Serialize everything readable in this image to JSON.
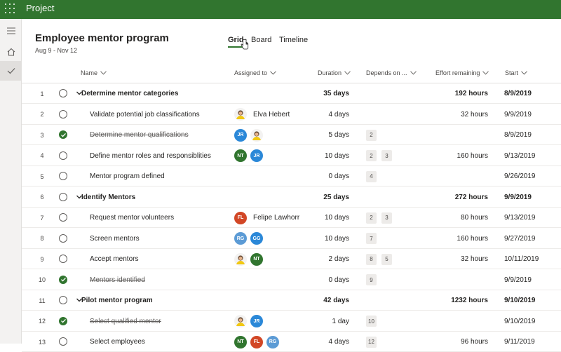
{
  "app": {
    "title": "Project"
  },
  "project": {
    "title": "Employee mentor program",
    "dates": "Aug 9 - Nov 12"
  },
  "tabs": [
    {
      "label": "Grid",
      "active": true
    },
    {
      "label": "Board"
    },
    {
      "label": "Timeline"
    }
  ],
  "columns": {
    "name": "Name",
    "assigned": "Assigned to",
    "duration": "Duration",
    "depends": "Depends on ...",
    "effort": "Effort remaining",
    "start": "Start"
  },
  "colors": {
    "brand": "#31752f",
    "complete": "#31752f"
  },
  "tasks": [
    {
      "num": "1",
      "name": "Determine mentor categories",
      "summary": true,
      "complete": false,
      "assignees": [],
      "assignee_name": "",
      "duration": "35 days",
      "depends": [],
      "effort": "192 hours",
      "start": "8/9/2019"
    },
    {
      "num": "2",
      "name": "Validate potential job classifications",
      "summary": false,
      "complete": false,
      "assignees": [
        {
          "type": "photo"
        }
      ],
      "assignee_name": "Elva Hebert",
      "duration": "4 days",
      "depends": [],
      "effort": "32 hours",
      "start": "9/9/2019"
    },
    {
      "num": "3",
      "name": "Determine mentor qualifications",
      "summary": false,
      "complete": true,
      "assignees": [
        {
          "initials": "JR",
          "color": "#2b88d8"
        },
        {
          "type": "photo"
        }
      ],
      "assignee_name": "",
      "duration": "5 days",
      "depends": [
        "2"
      ],
      "effort": "",
      "start": "8/9/2019"
    },
    {
      "num": "4",
      "name": "Define mentor roles and responsiblities",
      "summary": false,
      "complete": false,
      "assignees": [
        {
          "initials": "NT",
          "color": "#31752f"
        },
        {
          "initials": "JR",
          "color": "#2b88d8"
        }
      ],
      "assignee_name": "",
      "duration": "10 days",
      "depends": [
        "2",
        "3"
      ],
      "effort": "160 hours",
      "start": "9/13/2019"
    },
    {
      "num": "5",
      "name": "Mentor program defined",
      "summary": false,
      "complete": false,
      "assignees": [],
      "assignee_name": "",
      "duration": "0 days",
      "depends": [
        "4"
      ],
      "effort": "",
      "start": "9/26/2019"
    },
    {
      "num": "6",
      "name": "Identify Mentors",
      "summary": true,
      "complete": false,
      "assignees": [],
      "assignee_name": "",
      "duration": "25 days",
      "depends": [],
      "effort": "272 hours",
      "start": "9/9/2019"
    },
    {
      "num": "7",
      "name": "Request mentor volunteers",
      "summary": false,
      "complete": false,
      "assignees": [
        {
          "initials": "FL",
          "color": "#d24726"
        }
      ],
      "assignee_name": "Felipe Lawhorr",
      "duration": "10 days",
      "depends": [
        "2",
        "3"
      ],
      "effort": "80 hours",
      "start": "9/13/2019"
    },
    {
      "num": "8",
      "name": "Screen mentors",
      "summary": false,
      "complete": false,
      "assignees": [
        {
          "initials": "RG",
          "color": "#5c9bd5"
        },
        {
          "initials": "GG",
          "color": "#2b88d8"
        }
      ],
      "assignee_name": "",
      "duration": "10 days",
      "depends": [
        "7"
      ],
      "effort": "160 hours",
      "start": "9/27/2019"
    },
    {
      "num": "9",
      "name": "Accept mentors",
      "summary": false,
      "complete": false,
      "assignees": [
        {
          "type": "photo"
        },
        {
          "initials": "NT",
          "color": "#31752f"
        }
      ],
      "assignee_name": "",
      "duration": "2 days",
      "depends": [
        "8",
        "5"
      ],
      "effort": "32 hours",
      "start": "10/11/2019"
    },
    {
      "num": "10",
      "name": "Mentors identified",
      "summary": false,
      "complete": true,
      "assignees": [],
      "assignee_name": "",
      "duration": "0 days",
      "depends": [
        "9"
      ],
      "effort": "",
      "start": "9/9/2019"
    },
    {
      "num": "11",
      "name": "Pilot mentor program",
      "summary": true,
      "complete": false,
      "assignees": [],
      "assignee_name": "",
      "duration": "42 days",
      "depends": [],
      "effort": "1232 hours",
      "start": "9/10/2019"
    },
    {
      "num": "12",
      "name": "Select qualified mentor",
      "summary": false,
      "complete": true,
      "assignees": [
        {
          "type": "photo"
        },
        {
          "initials": "JR",
          "color": "#2b88d8"
        }
      ],
      "assignee_name": "",
      "duration": "1 day",
      "depends": [
        "10"
      ],
      "effort": "",
      "start": "9/10/2019"
    },
    {
      "num": "13",
      "name": "Select employees",
      "summary": false,
      "complete": false,
      "assignees": [
        {
          "initials": "NT",
          "color": "#31752f"
        },
        {
          "initials": "FL",
          "color": "#d24726"
        },
        {
          "initials": "RG",
          "color": "#5c9bd5"
        }
      ],
      "assignee_name": "",
      "duration": "4 days",
      "depends": [
        "12"
      ],
      "effort": "96 hours",
      "start": "9/11/2019"
    }
  ]
}
